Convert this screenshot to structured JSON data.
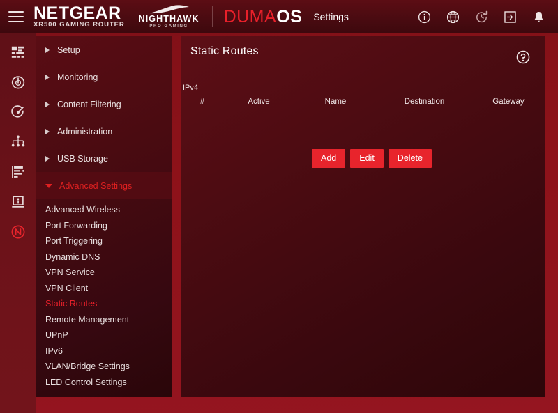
{
  "header": {
    "menu_icon": "hamburger-icon",
    "netgear_brand": "NETGEAR",
    "netgear_model": "XR500 GAMING ROUTER",
    "nighthawk_brand": "NIGHTHAWK",
    "nighthawk_sub": "PRO GAMING",
    "duma_red": "DUMA",
    "duma_white": "OS",
    "settings_label": "Settings",
    "icons": [
      {
        "name": "info-icon"
      },
      {
        "name": "globe-icon"
      },
      {
        "name": "refresh-clock-icon"
      },
      {
        "name": "logout-icon"
      },
      {
        "name": "bell-icon"
      }
    ]
  },
  "rail": {
    "icons": [
      {
        "name": "dashboard-icon"
      },
      {
        "name": "speedometer-icon"
      },
      {
        "name": "geo-filter-icon"
      },
      {
        "name": "network-map-icon"
      },
      {
        "name": "traffic-controller-icon"
      },
      {
        "name": "device-manager-icon"
      },
      {
        "name": "netduma-n-icon"
      }
    ]
  },
  "sidebar": {
    "groups": [
      {
        "label": "Setup",
        "open": false
      },
      {
        "label": "Monitoring",
        "open": false
      },
      {
        "label": "Content Filtering",
        "open": false
      },
      {
        "label": "Administration",
        "open": false
      },
      {
        "label": "USB Storage",
        "open": false
      },
      {
        "label": "Advanced Settings",
        "open": true
      }
    ],
    "subitems": [
      {
        "label": "Advanced Wireless",
        "active": false
      },
      {
        "label": "Port Forwarding",
        "active": false
      },
      {
        "label": "Port Triggering",
        "active": false
      },
      {
        "label": "Dynamic DNS",
        "active": false
      },
      {
        "label": "VPN Service",
        "active": false
      },
      {
        "label": "VPN Client",
        "active": false
      },
      {
        "label": "Static Routes",
        "active": true
      },
      {
        "label": "Remote Management",
        "active": false
      },
      {
        "label": "UPnP",
        "active": false
      },
      {
        "label": "IPv6",
        "active": false
      },
      {
        "label": "VLAN/Bridge Settings",
        "active": false
      },
      {
        "label": "LED Control Settings",
        "active": false
      }
    ]
  },
  "main": {
    "title": "Static Routes",
    "help_icon": "help-circle-icon",
    "section_label": "IPv4",
    "table": {
      "columns": [
        "#",
        "Active",
        "Name",
        "Destination",
        "Gateway"
      ],
      "rows": []
    },
    "buttons": [
      {
        "label": "Add"
      },
      {
        "label": "Edit"
      },
      {
        "label": "Delete"
      }
    ]
  },
  "colors": {
    "accent_red": "#e8242c",
    "brand_red": "#e8202a",
    "page_background": "#8d1219",
    "panel_dark": "#3a080e",
    "header_dark": "#4a0b11",
    "text_light": "#e8dede"
  }
}
